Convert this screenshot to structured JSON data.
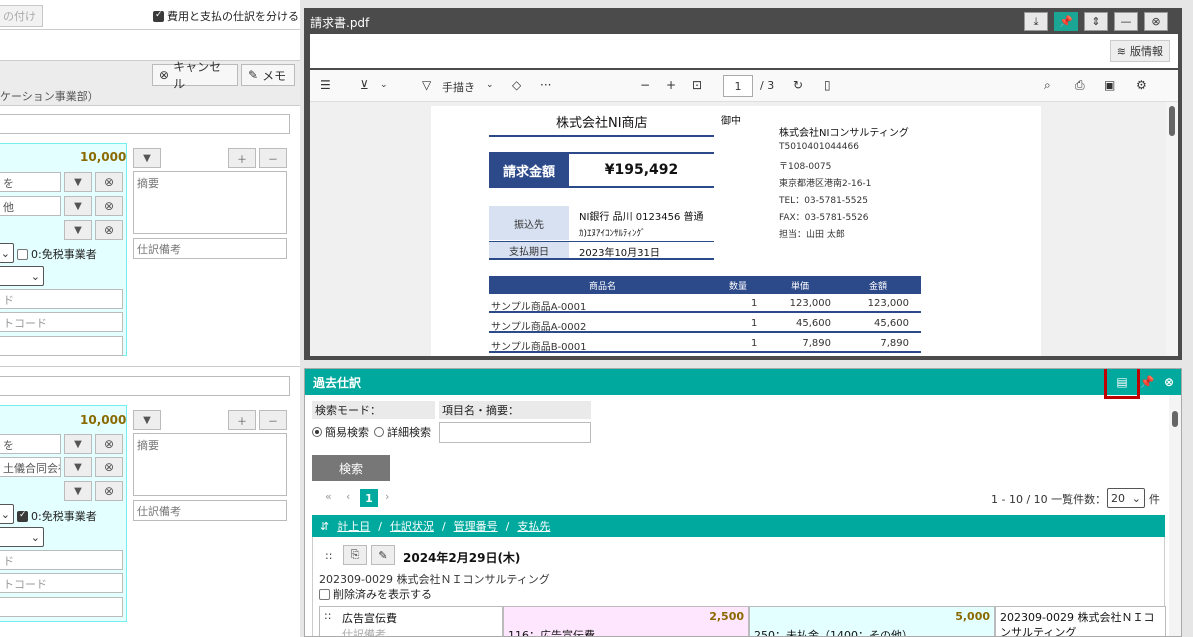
{
  "left": {
    "top_btn": "の付け",
    "split_check": "費用と支払の仕訳を分ける",
    "cancel": "キャンセル",
    "memo": "メモ",
    "dept": "ケーション事業部）",
    "blocks": [
      {
        "amount": "10,000",
        "row1": "を",
        "row2": "他",
        "summary_ph": "摘要",
        "remark_ph": "仕訳備考",
        "tax_label": "0:免税事業者",
        "code1": "ド",
        "code2": "トコード"
      },
      {
        "amount": "10,000",
        "row1": "を",
        "row2": "土儀合同会社",
        "summary_ph": "摘要",
        "remark_ph": "仕訳備考",
        "tax_label": "0:免税事業者",
        "code1": "ド",
        "code2": "トコード"
      }
    ]
  },
  "pdf": {
    "title": "請求書.pdf",
    "version_btn": "版情報",
    "freehand": "手描き",
    "page": "1",
    "pages": "/ 3",
    "doc": {
      "shop": "株式会社NI商店",
      "onchu": "御中",
      "billing_label": "請求金額",
      "billing_amount": "¥195,492",
      "bank_label": "振込先",
      "bank_line1": "NI銀行 品川 0123456 普通",
      "bank_line2": "ｶ)ｴﾇｱｲｺﾝｻﾙﾃｨﾝｸﾞ",
      "due_label": "支払期日",
      "due_date": "2023年10月31日",
      "issuer": "株式会社NIコンサルティング",
      "reg_no": "T5010401044466",
      "zip": "〒108-0075",
      "address": "東京都港区港南2-16-1",
      "tel": "TEL：03-5781-5525",
      "fax": "FAX：03-5781-5526",
      "staff": "担当：山田 太郎",
      "headers": [
        "商品名",
        "数量",
        "単価",
        "金額"
      ],
      "rows": [
        [
          "サンプル商品A-0001",
          "1",
          "123,000",
          "123,000"
        ],
        [
          "サンプル商品A-0002",
          "1",
          "45,600",
          "45,600"
        ],
        [
          "サンプル商品B-0001",
          "1",
          "7,890",
          "7,890"
        ]
      ]
    }
  },
  "past": {
    "title": "過去仕訳",
    "mode_label": "検索モード：",
    "field_label": "項目名・摘要：",
    "simple": "簡易検索",
    "detail": "詳細検索",
    "search_btn": "検索",
    "page_current": "1",
    "count_text": "1 - 10 / 10 一覧件数：",
    "per_page": "20",
    "per_page_unit": "件",
    "sort_items": [
      "計上日",
      "仕訳状況",
      "管理番号",
      "支払先"
    ],
    "date": "2024年2月29日(木)",
    "entry_ref": "202309-0029 株式会社ＮＩコンサルティング",
    "show_deleted": "削除済みを表示する",
    "debit_account": "広告宣伝費",
    "debit_remark_ph": "仕訳備考",
    "debit_amount": "2,500",
    "debit_code": "116：広告宣伝費",
    "credit_amount": "5,000",
    "credit_code": "250：未払金（1400：その他）",
    "summary": "202309-0029 株式会社ＮＩコンサルティング"
  }
}
